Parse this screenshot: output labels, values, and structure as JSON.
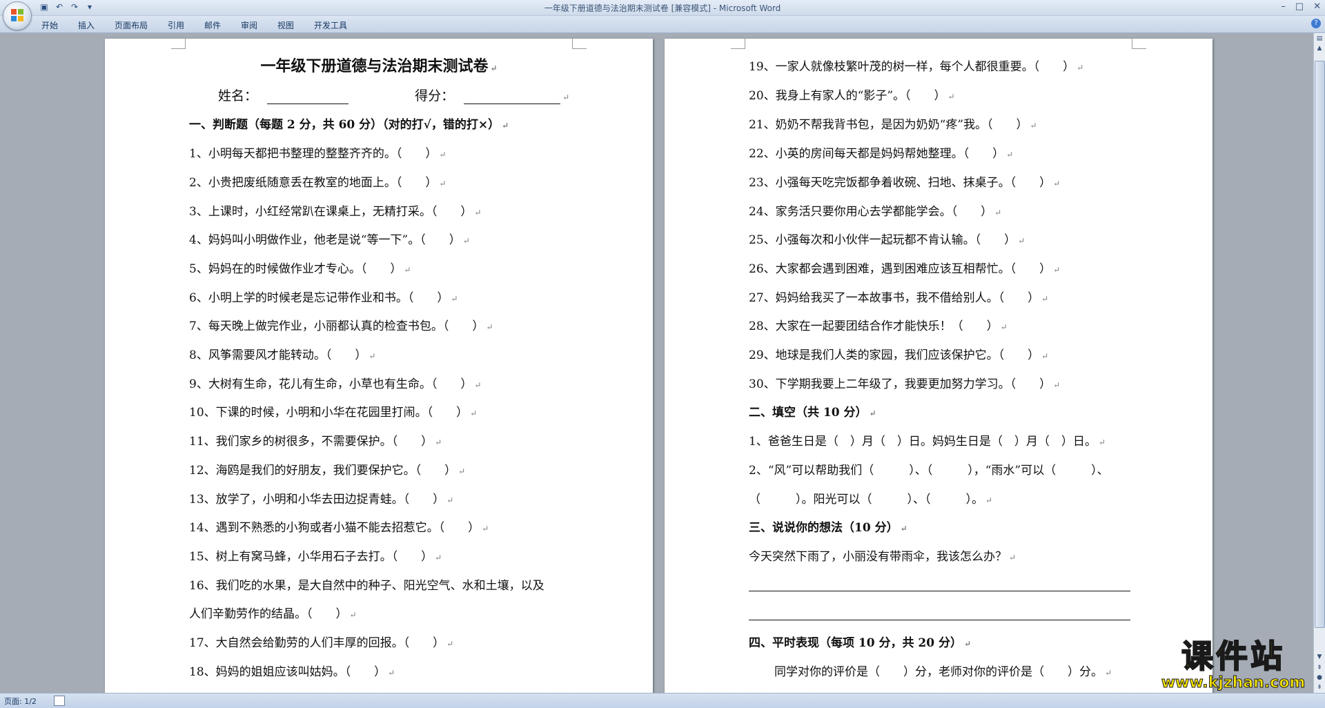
{
  "window": {
    "title": "一年级下册道德与法治期末测试卷 [兼容模式] - Microsoft Word"
  },
  "ribbon": {
    "tabs": [
      "开始",
      "插入",
      "页面布局",
      "引用",
      "邮件",
      "审阅",
      "视图",
      "开发工具"
    ]
  },
  "status_bar": {
    "page": "页面: 1/2"
  },
  "watermark": {
    "text": "课件站",
    "url": "www.kjzhan.com"
  },
  "page1": {
    "title": "一年级下册道德与法治期末测试卷",
    "name_label": "姓名：",
    "score_label": "得分：",
    "section1_heading": "一、判断题（每题 2 分，共 60 分）（对的打√，错的打×）",
    "items": [
      "1、小明每天都把书整理的整整齐齐的。（　　）",
      "2、小贵把废纸随意丢在教室的地面上。（　　）",
      "3、上课时，小红经常趴在课桌上，无精打采。（　　）",
      "4、妈妈叫小明做作业，他老是说“等一下”。（　　）",
      "5、妈妈在的时候做作业才专心。（　　）",
      "6、小明上学的时候老是忘记带作业和书。（　　）",
      "7、每天晚上做完作业，小丽都认真的检查书包。（　　）",
      "8、风筝需要风才能转动。（　　）",
      "9、大树有生命，花儿有生命，小草也有生命。（　　）",
      "10、下课的时候，小明和小华在花园里打闹。（　　）",
      "11、我们家乡的树很多，不需要保护。（　　）",
      "12、海鸥是我们的好朋友，我们要保护它。（　　）",
      "13、放学了，小明和小华去田边捉青蛙。（　　）",
      "14、遇到不熟悉的小狗或者小猫不能去招惹它。（　　）",
      "15、树上有窝马蜂，小华用石子去打。（　　）",
      "16、我们吃的水果，是大自然中的种子、阳光空气、水和土壤，以及",
      "人们辛勤劳作的结晶。（　　）",
      "17、大自然会给勤劳的人们丰厚的回报。（　　）",
      "18、妈妈的姐姐应该叫姑妈。（　　）"
    ]
  },
  "page2": {
    "items": [
      "19、一家人就像枝繁叶茂的树一样，每个人都很重要。（　　）",
      "20、我身上有家人的“影子”。（　　）",
      "21、奶奶不帮我背书包，是因为奶奶“疼”我。（　　）",
      "22、小英的房间每天都是妈妈帮她整理。（　　）",
      "23、小强每天吃完饭都争着收碗、扫地、抹桌子。（　　）",
      "24、家务活只要你用心去学都能学会。（　　）",
      "25、小强每次和小伙伴一起玩都不肯认输。（　　）",
      "26、大家都会遇到困难，遇到困难应该互相帮忙。（　　）",
      "27、妈妈给我买了一本故事书，我不借给别人。（　　）",
      "28、大家在一起要团结合作才能快乐！（　　）",
      "29、地球是我们人类的家园，我们应该保护它。（　　）",
      "30、下学期我要上二年级了，我要更加努力学习。（　　）"
    ],
    "section2_heading": "二、填空（共 10 分）",
    "fill1": "1、爸爸生日是（　）月（　）日。妈妈生日是（　）月（　）日。",
    "fill2a": "2、“风”可以帮助我们（　　　）、（　　　），“雨水”可以（　　　）、",
    "fill2b": "（　　　）。阳光可以（　　　）、（　　　）。",
    "section3_heading": "三、说说你的想法（10 分）",
    "question3": "今天突然下雨了，小丽没有带雨伞，我该怎么办？",
    "section4_heading": "四、平时表现（每项 10 分，共 20 分）",
    "evaluation": "同学对你的评价是（　　）分，老师对你的评价是（　　）分。"
  }
}
